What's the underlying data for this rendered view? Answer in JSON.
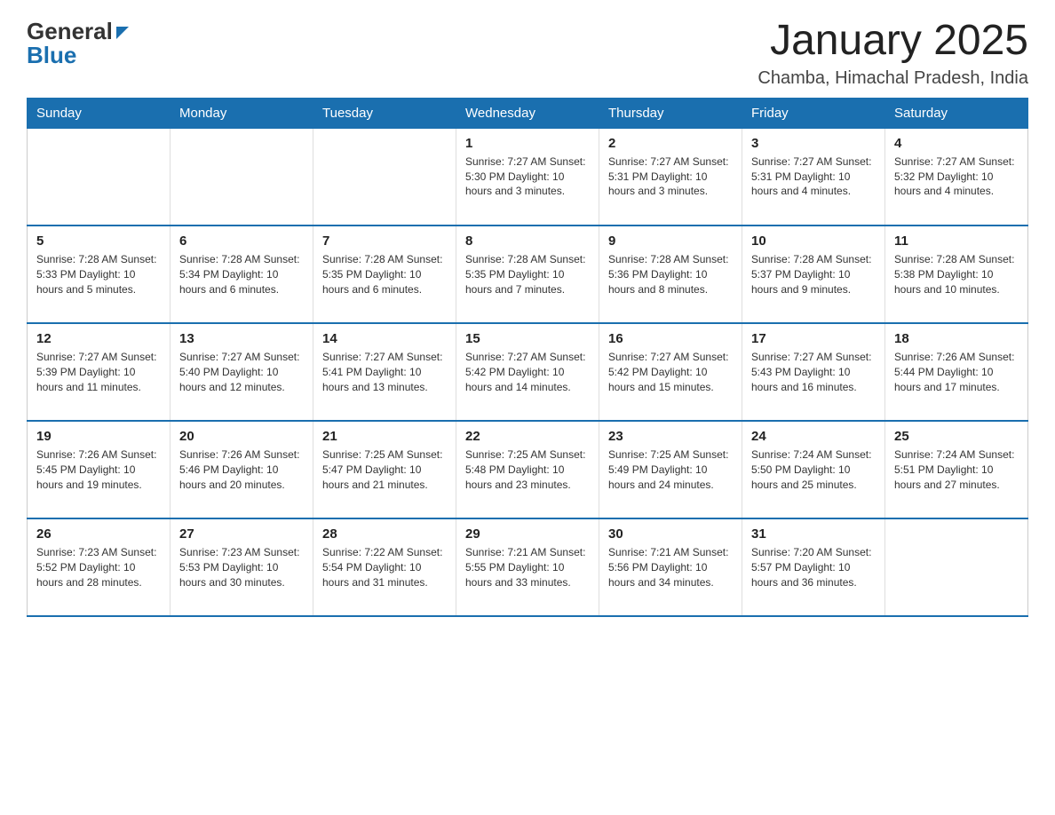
{
  "logo": {
    "text_general": "General",
    "text_blue": "Blue"
  },
  "header": {
    "month": "January 2025",
    "location": "Chamba, Himachal Pradesh, India"
  },
  "weekdays": [
    "Sunday",
    "Monday",
    "Tuesday",
    "Wednesday",
    "Thursday",
    "Friday",
    "Saturday"
  ],
  "weeks": [
    [
      {
        "day": "",
        "info": ""
      },
      {
        "day": "",
        "info": ""
      },
      {
        "day": "",
        "info": ""
      },
      {
        "day": "1",
        "info": "Sunrise: 7:27 AM\nSunset: 5:30 PM\nDaylight: 10 hours and 3 minutes."
      },
      {
        "day": "2",
        "info": "Sunrise: 7:27 AM\nSunset: 5:31 PM\nDaylight: 10 hours and 3 minutes."
      },
      {
        "day": "3",
        "info": "Sunrise: 7:27 AM\nSunset: 5:31 PM\nDaylight: 10 hours and 4 minutes."
      },
      {
        "day": "4",
        "info": "Sunrise: 7:27 AM\nSunset: 5:32 PM\nDaylight: 10 hours and 4 minutes."
      }
    ],
    [
      {
        "day": "5",
        "info": "Sunrise: 7:28 AM\nSunset: 5:33 PM\nDaylight: 10 hours and 5 minutes."
      },
      {
        "day": "6",
        "info": "Sunrise: 7:28 AM\nSunset: 5:34 PM\nDaylight: 10 hours and 6 minutes."
      },
      {
        "day": "7",
        "info": "Sunrise: 7:28 AM\nSunset: 5:35 PM\nDaylight: 10 hours and 6 minutes."
      },
      {
        "day": "8",
        "info": "Sunrise: 7:28 AM\nSunset: 5:35 PM\nDaylight: 10 hours and 7 minutes."
      },
      {
        "day": "9",
        "info": "Sunrise: 7:28 AM\nSunset: 5:36 PM\nDaylight: 10 hours and 8 minutes."
      },
      {
        "day": "10",
        "info": "Sunrise: 7:28 AM\nSunset: 5:37 PM\nDaylight: 10 hours and 9 minutes."
      },
      {
        "day": "11",
        "info": "Sunrise: 7:28 AM\nSunset: 5:38 PM\nDaylight: 10 hours and 10 minutes."
      }
    ],
    [
      {
        "day": "12",
        "info": "Sunrise: 7:27 AM\nSunset: 5:39 PM\nDaylight: 10 hours and 11 minutes."
      },
      {
        "day": "13",
        "info": "Sunrise: 7:27 AM\nSunset: 5:40 PM\nDaylight: 10 hours and 12 minutes."
      },
      {
        "day": "14",
        "info": "Sunrise: 7:27 AM\nSunset: 5:41 PM\nDaylight: 10 hours and 13 minutes."
      },
      {
        "day": "15",
        "info": "Sunrise: 7:27 AM\nSunset: 5:42 PM\nDaylight: 10 hours and 14 minutes."
      },
      {
        "day": "16",
        "info": "Sunrise: 7:27 AM\nSunset: 5:42 PM\nDaylight: 10 hours and 15 minutes."
      },
      {
        "day": "17",
        "info": "Sunrise: 7:27 AM\nSunset: 5:43 PM\nDaylight: 10 hours and 16 minutes."
      },
      {
        "day": "18",
        "info": "Sunrise: 7:26 AM\nSunset: 5:44 PM\nDaylight: 10 hours and 17 minutes."
      }
    ],
    [
      {
        "day": "19",
        "info": "Sunrise: 7:26 AM\nSunset: 5:45 PM\nDaylight: 10 hours and 19 minutes."
      },
      {
        "day": "20",
        "info": "Sunrise: 7:26 AM\nSunset: 5:46 PM\nDaylight: 10 hours and 20 minutes."
      },
      {
        "day": "21",
        "info": "Sunrise: 7:25 AM\nSunset: 5:47 PM\nDaylight: 10 hours and 21 minutes."
      },
      {
        "day": "22",
        "info": "Sunrise: 7:25 AM\nSunset: 5:48 PM\nDaylight: 10 hours and 23 minutes."
      },
      {
        "day": "23",
        "info": "Sunrise: 7:25 AM\nSunset: 5:49 PM\nDaylight: 10 hours and 24 minutes."
      },
      {
        "day": "24",
        "info": "Sunrise: 7:24 AM\nSunset: 5:50 PM\nDaylight: 10 hours and 25 minutes."
      },
      {
        "day": "25",
        "info": "Sunrise: 7:24 AM\nSunset: 5:51 PM\nDaylight: 10 hours and 27 minutes."
      }
    ],
    [
      {
        "day": "26",
        "info": "Sunrise: 7:23 AM\nSunset: 5:52 PM\nDaylight: 10 hours and 28 minutes."
      },
      {
        "day": "27",
        "info": "Sunrise: 7:23 AM\nSunset: 5:53 PM\nDaylight: 10 hours and 30 minutes."
      },
      {
        "day": "28",
        "info": "Sunrise: 7:22 AM\nSunset: 5:54 PM\nDaylight: 10 hours and 31 minutes."
      },
      {
        "day": "29",
        "info": "Sunrise: 7:21 AM\nSunset: 5:55 PM\nDaylight: 10 hours and 33 minutes."
      },
      {
        "day": "30",
        "info": "Sunrise: 7:21 AM\nSunset: 5:56 PM\nDaylight: 10 hours and 34 minutes."
      },
      {
        "day": "31",
        "info": "Sunrise: 7:20 AM\nSunset: 5:57 PM\nDaylight: 10 hours and 36 minutes."
      },
      {
        "day": "",
        "info": ""
      }
    ]
  ]
}
